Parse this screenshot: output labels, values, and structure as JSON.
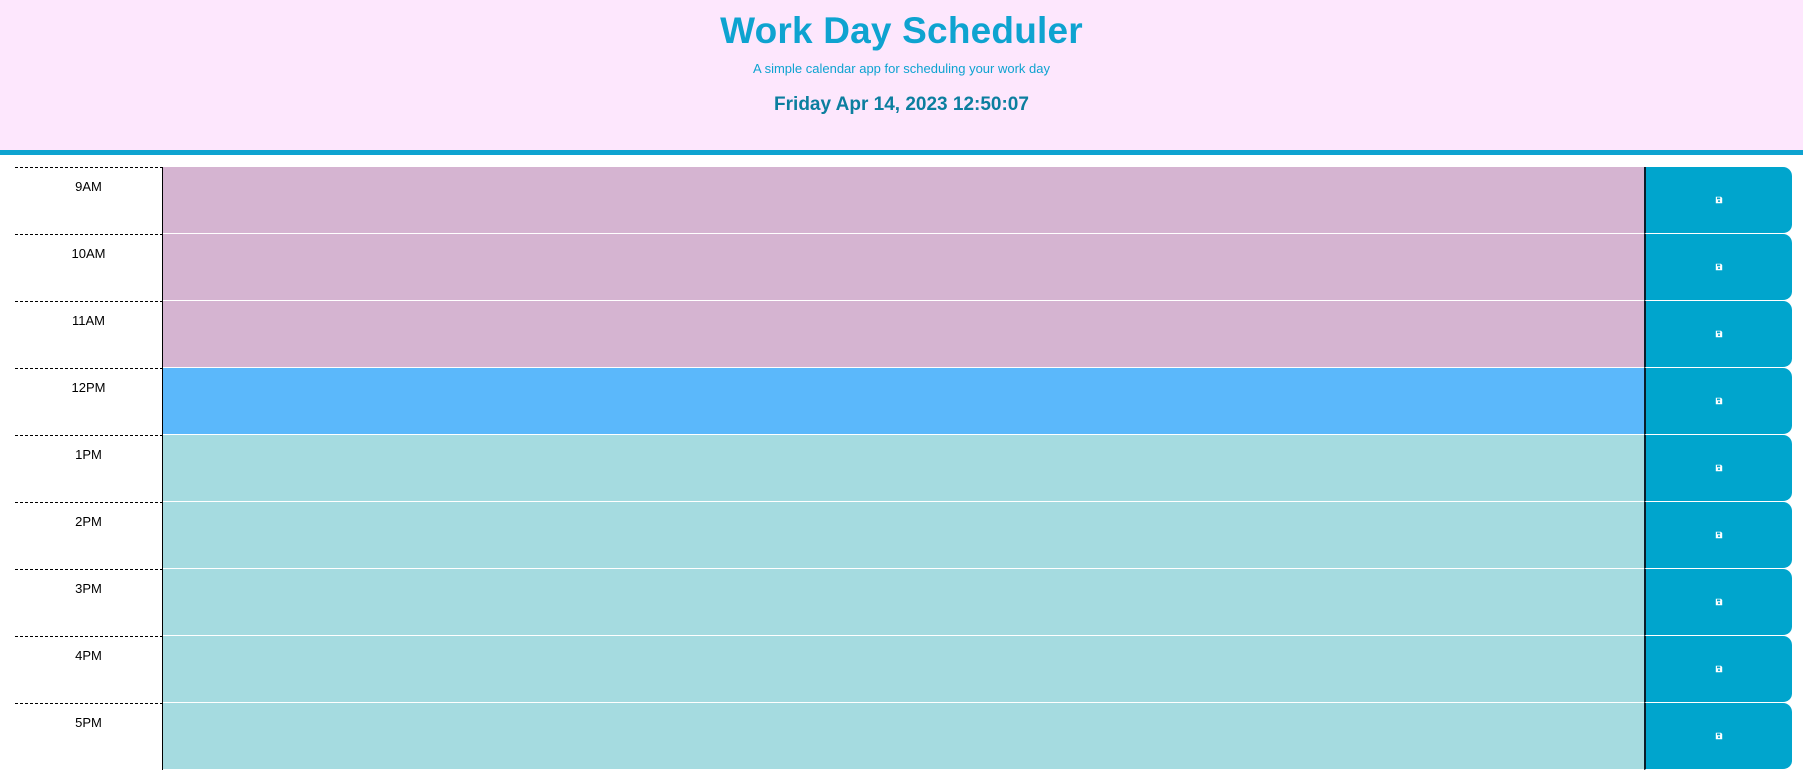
{
  "header": {
    "title": "Work Day Scheduler",
    "subtitle": "A simple calendar app for scheduling your work day",
    "current_day": "Friday Apr 14, 2023 12:50:07"
  },
  "colors": {
    "past": "#d5b4d1",
    "present": "#5bb8fb",
    "future": "#a5dbe0",
    "accent": "#0ea3d0",
    "header_background": "#fde7fd",
    "save_button": "#00a5cd"
  },
  "time_blocks": [
    {
      "hour": "9AM",
      "state": "past",
      "description": "",
      "save_icon": "save-icon"
    },
    {
      "hour": "10AM",
      "state": "past",
      "description": "",
      "save_icon": "save-icon"
    },
    {
      "hour": "11AM",
      "state": "past",
      "description": "",
      "save_icon": "save-icon"
    },
    {
      "hour": "12PM",
      "state": "present",
      "description": "",
      "save_icon": "save-icon"
    },
    {
      "hour": "1PM",
      "state": "future",
      "description": "",
      "save_icon": "save-icon"
    },
    {
      "hour": "2PM",
      "state": "future",
      "description": "",
      "save_icon": "save-icon"
    },
    {
      "hour": "3PM",
      "state": "future",
      "description": "",
      "save_icon": "save-icon"
    },
    {
      "hour": "4PM",
      "state": "future",
      "description": "",
      "save_icon": "save-icon"
    },
    {
      "hour": "5PM",
      "state": "future",
      "description": "",
      "save_icon": "save-icon"
    }
  ]
}
